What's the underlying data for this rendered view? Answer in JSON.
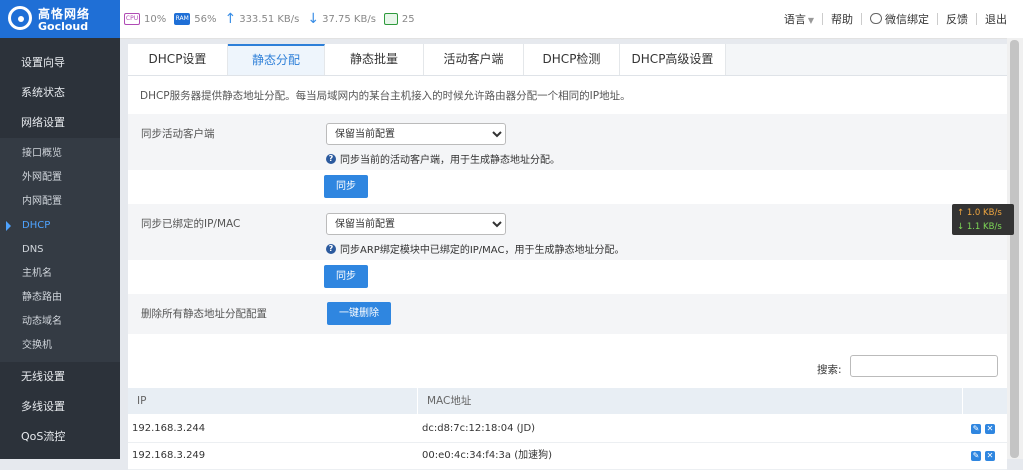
{
  "brand": {
    "name_cn": "高恪网络",
    "name_en": "Gocloud"
  },
  "stats": {
    "cpu_icon": "CPU",
    "cpu": "10%",
    "ram_icon": "RAM",
    "ram": "56%",
    "upload": "333.51 KB/s",
    "download": "37.75 KB/s",
    "clients": "25"
  },
  "top_menu": {
    "language": "语言",
    "help": "帮助",
    "wechat": "微信绑定",
    "feedback": "反馈",
    "logout": "退出"
  },
  "sidebar": {
    "wizard": "设置向导",
    "status": "系统状态",
    "network": "网络设置",
    "network_sub": [
      "接口概览",
      "外网配置",
      "内网配置",
      "DHCP",
      "DNS",
      "主机名",
      "静态路由",
      "动态域名",
      "交换机"
    ],
    "wireless": "无线设置",
    "multiwan": "多线设置",
    "qos": "QoS流控"
  },
  "tabs": [
    "DHCP设置",
    "静态分配",
    "静态批量",
    "活动客户端",
    "DHCP检测",
    "DHCP高级设置"
  ],
  "description": "DHCP服务器提供静态地址分配。每当局域网内的某台主机接入的时候允许路由器分配一个相同的IP地址。",
  "sync_active": {
    "label": "同步活动客户端",
    "selected": "保留当前配置",
    "hint": "同步当前的活动客户端，用于生成静态地址分配。",
    "button": "同步"
  },
  "sync_bound": {
    "label": "同步已绑定的IP/MAC",
    "selected": "保留当前配置",
    "hint": "同步ARP绑定模块中已绑定的IP/MAC，用于生成静态地址分配。",
    "button": "同步"
  },
  "delete_all": {
    "label": "删除所有静态地址分配配置",
    "button": "一键删除"
  },
  "search": {
    "label": "搜索:"
  },
  "table": {
    "columns": [
      "IP",
      "MAC地址"
    ],
    "rows": [
      {
        "ip": "192.168.3.244",
        "mac": "dc:d8:7c:12:18:04 (JD)"
      },
      {
        "ip": "192.168.3.249",
        "mac": "00:e0:4c:34:f4:3a (加速狗)"
      }
    ]
  },
  "speed_widget": {
    "up": "↑ 1.0 KB/s",
    "down": "↓ 1.1 KB/s"
  }
}
